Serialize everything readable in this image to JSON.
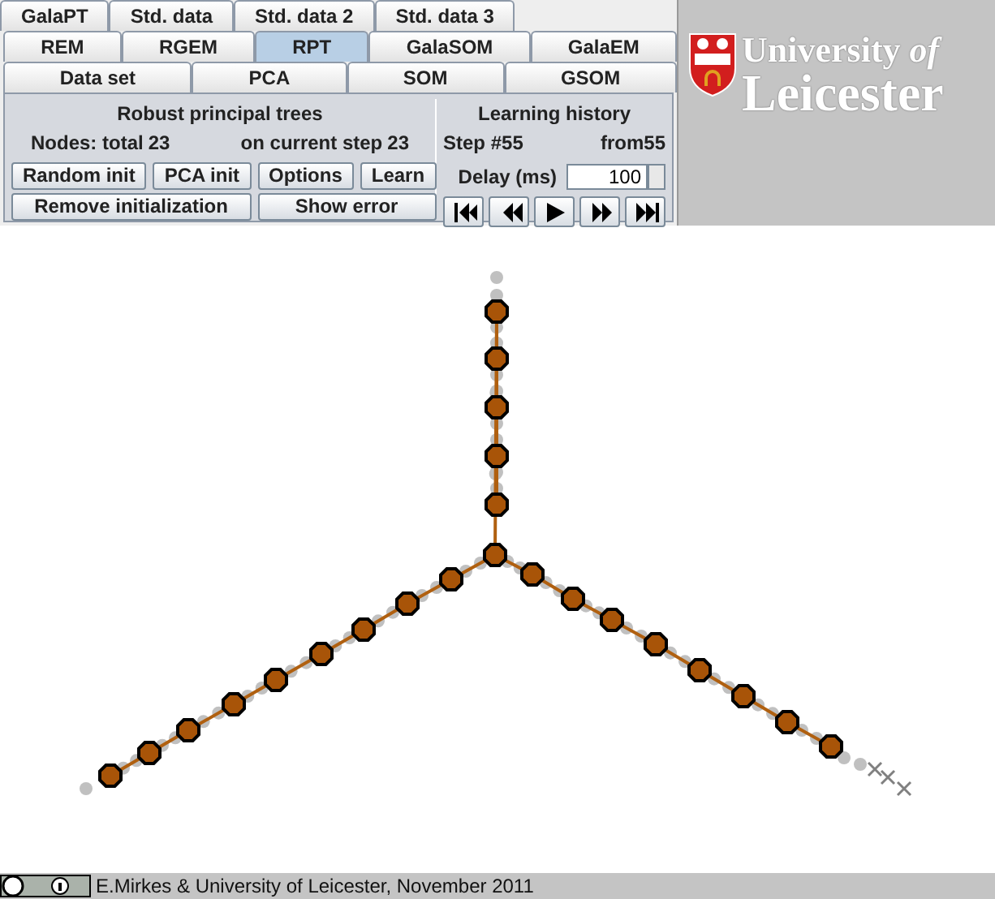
{
  "tab_rows": [
    [
      {
        "label": "GalaPT",
        "selected": false
      },
      {
        "label": "Std. data",
        "selected": false
      },
      {
        "label": "Std. data 2",
        "selected": false
      },
      {
        "label": "Std. data 3",
        "selected": false
      }
    ],
    [
      {
        "label": "REM",
        "selected": false
      },
      {
        "label": "RGEM",
        "selected": false
      },
      {
        "label": "RPT",
        "selected": true
      },
      {
        "label": "GalaSOM",
        "selected": false
      },
      {
        "label": "GalaEM",
        "selected": false
      }
    ],
    [
      {
        "label": "Data set",
        "selected": false
      },
      {
        "label": "PCA",
        "selected": false
      },
      {
        "label": "SOM",
        "selected": false
      },
      {
        "label": "GSOM",
        "selected": false
      }
    ]
  ],
  "method_panel": {
    "title": "Robust principal trees",
    "nodes_total_label": "Nodes: total",
    "nodes_total": "23",
    "current_step_label": "on current step",
    "current_step": "23",
    "buttons": [
      "Random init",
      "PCA init",
      "Options",
      "Learn",
      "Remove initialization",
      "Show error"
    ]
  },
  "history_panel": {
    "title": "Learning history",
    "step_label": "Step #",
    "step": "55",
    "from_label": "from",
    "from": "55",
    "delay_label": "Delay (ms)",
    "delay": "100"
  },
  "logo": {
    "line1": "University *of*",
    "line2": "Leicester"
  },
  "footer": {
    "text": "E.Mirkes & University of Leicester, November 2011"
  }
}
